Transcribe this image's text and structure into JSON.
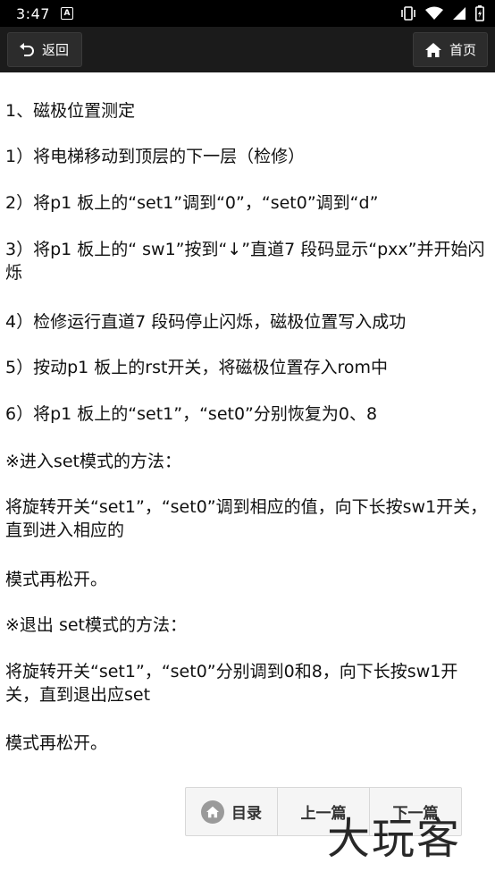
{
  "status": {
    "time": "3:47",
    "notif_letter": "A"
  },
  "appbar": {
    "back_label": "返回",
    "home_label": "首页"
  },
  "article": {
    "paragraphs": [
      "1、磁极位置测定",
      "1）将电梯移动到顶层的下一层（检修）",
      "2）将p1 板上的“set1”调到“0”，“set0”调到“d”",
      "3）将p1 板上的“ sw1”按到“↓”直道7 段码显示“pxx”并开始闪烁",
      "4）检修运行直道7 段码停止闪烁，磁极位置写入成功",
      "5）按动p1 板上的rst开关，将磁极位置存入rom中",
      "6）将p1 板上的“set1”，“set0”分别恢复为0、8",
      "※进入set模式的方法：",
      "将旋转开关“set1”，“set0”调到相应的值，向下长按sw1开关，直到进入相应的",
      "模式再松开。",
      "※退出 set模式的方法：",
      "将旋转开关“set1”，“set0”分别调到0和8，向下长按sw1开关，直到退出应set",
      "模式再松开。"
    ]
  },
  "bottom_nav": {
    "toc_label": "目录",
    "prev_label": "上一篇",
    "next_label": "下一篇"
  },
  "watermark": "大玩客"
}
